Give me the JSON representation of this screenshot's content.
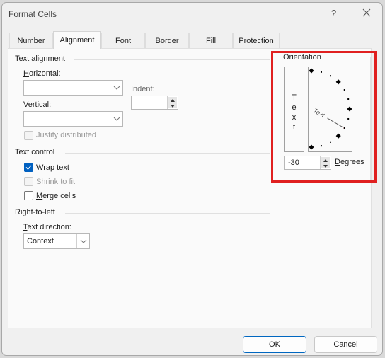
{
  "window": {
    "title": "Format Cells",
    "help_label": "?",
    "close_icon": "close-icon"
  },
  "tabs": [
    {
      "label": "Number"
    },
    {
      "label": "Alignment",
      "active": true
    },
    {
      "label": "Font"
    },
    {
      "label": "Border"
    },
    {
      "label": "Fill"
    },
    {
      "label": "Protection"
    }
  ],
  "text_alignment": {
    "heading": "Text alignment",
    "horizontal": {
      "label_u": "H",
      "label_rest": "orizontal:",
      "value": ""
    },
    "vertical": {
      "label_u": "V",
      "label_rest": "ertical:",
      "value": ""
    },
    "indent": {
      "label": "Indent:",
      "value": ""
    },
    "justify_distributed": {
      "label": "Justify distributed",
      "checked": false,
      "disabled": true
    }
  },
  "text_control": {
    "heading": "Text control",
    "wrap_text": {
      "label_u": "W",
      "label_rest": "rap text",
      "checked": true
    },
    "shrink_to_fit": {
      "label": "Shrink to fit",
      "checked": false,
      "disabled": true
    },
    "merge_cells": {
      "label_u": "M",
      "label_rest": "erge cells",
      "checked": false
    }
  },
  "right_to_left": {
    "heading": "Right-to-left",
    "text_direction": {
      "label_u": "T",
      "label_rest": "ext direction:",
      "value": "Context"
    }
  },
  "orientation": {
    "heading": "Orientation",
    "vertical_text": [
      "T",
      "e",
      "x",
      "t"
    ],
    "dial_text": "Text",
    "degrees_value": "-30",
    "degrees_label_u": "D",
    "degrees_label_rest": "egrees",
    "angle_degrees": -30,
    "highlight_color": "#e02020"
  },
  "footer": {
    "ok_label": "OK",
    "cancel_label": "Cancel"
  }
}
